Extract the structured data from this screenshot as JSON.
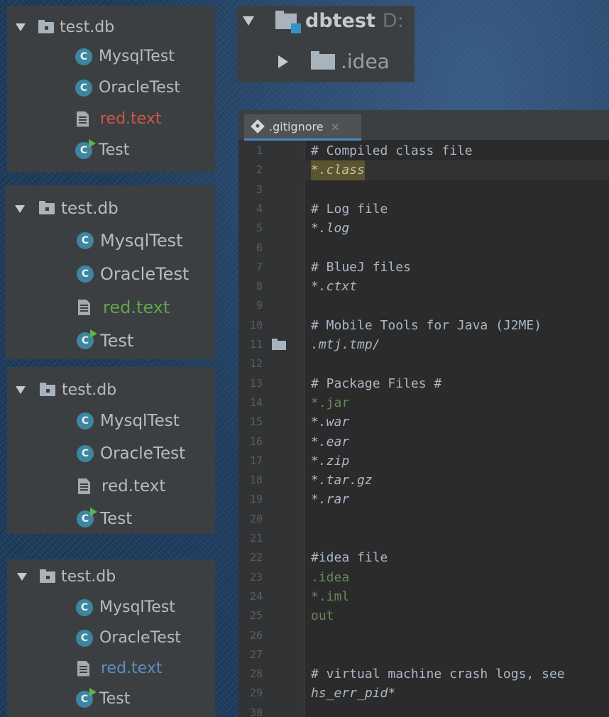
{
  "tree_panels": [
    {
      "root": "test.db",
      "items": [
        {
          "label": "MysqlTest",
          "kind": "class",
          "status": "normal"
        },
        {
          "label": "OracleTest",
          "kind": "class",
          "status": "normal"
        },
        {
          "label": "red.text",
          "kind": "text",
          "status": "red"
        },
        {
          "label": "Test",
          "kind": "runnable",
          "status": "normal"
        }
      ]
    },
    {
      "root": "test.db",
      "items": [
        {
          "label": "MysqlTest",
          "kind": "class",
          "status": "normal"
        },
        {
          "label": "OracleTest",
          "kind": "class",
          "status": "normal"
        },
        {
          "label": "red.text",
          "kind": "text",
          "status": "green"
        },
        {
          "label": "Test",
          "kind": "runnable",
          "status": "normal"
        }
      ]
    },
    {
      "root": "test.db",
      "items": [
        {
          "label": "MysqlTest",
          "kind": "class",
          "status": "normal"
        },
        {
          "label": "OracleTest",
          "kind": "class",
          "status": "normal"
        },
        {
          "label": "red.text",
          "kind": "text",
          "status": "normal"
        },
        {
          "label": "Test",
          "kind": "runnable",
          "status": "normal"
        }
      ]
    },
    {
      "root": "test.db",
      "items": [
        {
          "label": "MysqlTest",
          "kind": "class",
          "status": "normal"
        },
        {
          "label": "OracleTest",
          "kind": "class",
          "status": "normal"
        },
        {
          "label": "red.text",
          "kind": "text",
          "status": "blue"
        },
        {
          "label": "Test",
          "kind": "runnable",
          "status": "normal"
        }
      ]
    }
  ],
  "class_icon_letter": "C",
  "project": {
    "name": "dbtest",
    "path_fragment": "D:",
    "child_folder": ".idea"
  },
  "editor": {
    "tab_label": ".gitignore",
    "tab_close": "×",
    "lines": [
      {
        "n": "1",
        "text": "# Compiled class file",
        "style": "comment"
      },
      {
        "n": "2",
        "text": "*.class",
        "style": "highlight"
      },
      {
        "n": "3",
        "text": "",
        "style": "comment"
      },
      {
        "n": "4",
        "text": "# Log file",
        "style": "comment"
      },
      {
        "n": "5",
        "text": "*.log",
        "style": "pattern"
      },
      {
        "n": "6",
        "text": "",
        "style": "comment"
      },
      {
        "n": "7",
        "text": "# BlueJ files",
        "style": "comment"
      },
      {
        "n": "8",
        "text": "*.ctxt",
        "style": "pattern"
      },
      {
        "n": "9",
        "text": "",
        "style": "comment"
      },
      {
        "n": "10",
        "text": "# Mobile Tools for Java (J2ME)",
        "style": "comment"
      },
      {
        "n": "11",
        "text": ".mtj.tmp/",
        "style": "pattern",
        "folder": true
      },
      {
        "n": "12",
        "text": "",
        "style": "comment"
      },
      {
        "n": "13",
        "text": "# Package Files #",
        "style": "comment"
      },
      {
        "n": "14",
        "text": "*.jar",
        "style": "ignored"
      },
      {
        "n": "15",
        "text": "*.war",
        "style": "pattern"
      },
      {
        "n": "16",
        "text": "*.ear",
        "style": "pattern"
      },
      {
        "n": "17",
        "text": "*.zip",
        "style": "pattern"
      },
      {
        "n": "18",
        "text": "*.tar.gz",
        "style": "pattern"
      },
      {
        "n": "19",
        "text": "*.rar",
        "style": "pattern"
      },
      {
        "n": "20",
        "text": "",
        "style": "comment"
      },
      {
        "n": "21",
        "text": "",
        "style": "comment"
      },
      {
        "n": "22",
        "text": "#idea file",
        "style": "comment"
      },
      {
        "n": "23",
        "text": ".idea",
        "style": "ignored"
      },
      {
        "n": "24",
        "text": "*.iml",
        "style": "ignored"
      },
      {
        "n": "25",
        "text": "out",
        "style": "ignored"
      },
      {
        "n": "26",
        "text": "",
        "style": "comment"
      },
      {
        "n": "27",
        "text": "",
        "style": "comment"
      },
      {
        "n": "28",
        "text": "# virtual machine crash logs, see",
        "style": "comment"
      },
      {
        "n": "29",
        "text": "hs_err_pid*",
        "style": "pattern"
      },
      {
        "n": "30",
        "text": "",
        "style": "comment"
      }
    ]
  },
  "colors": {
    "panel_bg": "#3c3f41",
    "editor_bg": "#2b2b2b",
    "status_red": "#d2554a",
    "status_green": "#62a34d",
    "status_blue": "#5a8fc5",
    "ignored_green": "#6a8759"
  },
  "icons": {
    "tree_expand": "arrow-down-icon",
    "folder": "package-folder-icon",
    "class": "class-icon",
    "runnable": "runnable-class-icon",
    "text": "text-file-icon",
    "module": "module-folder-icon",
    "git": "gitignore-icon"
  }
}
